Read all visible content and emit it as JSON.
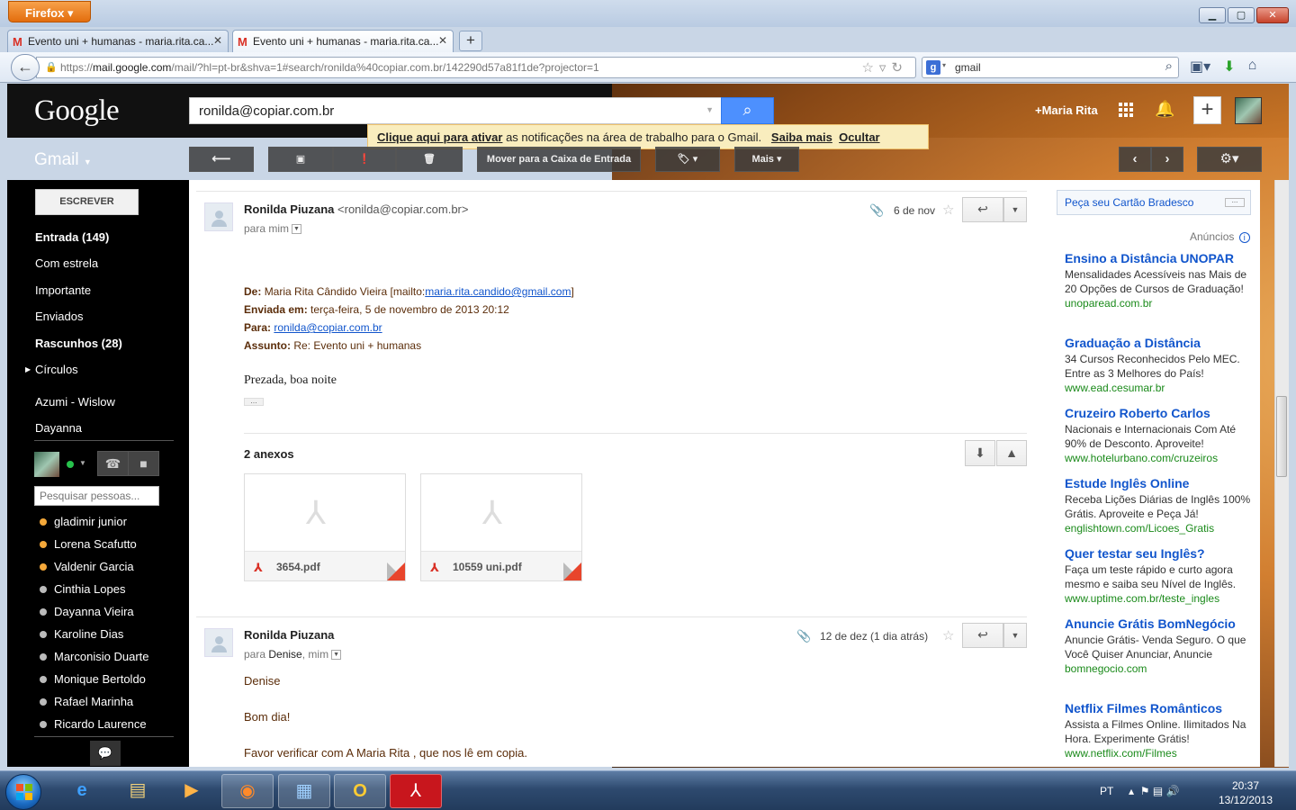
{
  "browser": {
    "menu_button": "Firefox",
    "tabs": [
      {
        "label": "Evento uni + humanas - maria.rita.ca..."
      },
      {
        "label": "Evento uni + humanas - maria.rita.ca..."
      }
    ],
    "url_prefix": "https://",
    "url_host": "mail.google.com",
    "url_path": "/mail/?hl=pt-br&shva=1#search/ronilda%40copiar.com.br/142290d57a81f1de?projector=1",
    "search_value": "gmail"
  },
  "gmail": {
    "logo": "Google",
    "search_value": "ronilda@copiar.com.br",
    "user_link": "+Maria Rita",
    "notification": {
      "activate_link": "Clique aqui para ativar",
      "text": "as notificações na área de trabalho para o Gmail.",
      "learn_more": "Saiba mais",
      "hide": "Ocultar"
    },
    "app_label": "Gmail",
    "toolbar": {
      "move_inbox": "Mover para a Caixa de Entrada",
      "more": "Mais"
    },
    "compose": "ESCREVER",
    "labels": [
      {
        "label": "Entrada (149)"
      },
      {
        "label": "Com estrela"
      },
      {
        "label": "Importante"
      },
      {
        "label": "Enviados"
      },
      {
        "label": "Rascunhos (28)"
      },
      {
        "label": "Círculos"
      },
      {
        "label": "Azumi - Wislow"
      },
      {
        "label": "Dayanna"
      }
    ],
    "people_search_placeholder": "Pesquisar pessoas...",
    "contacts": [
      {
        "name": "gladimir junior",
        "status": "#f4a83a"
      },
      {
        "name": "Lorena Scafutto",
        "status": "#f4a83a"
      },
      {
        "name": "Valdenir Garcia",
        "status": "#f4a83a"
      },
      {
        "name": "Cinthia Lopes",
        "status": "#bbbbbb"
      },
      {
        "name": "Dayanna Vieira",
        "status": "#bbbbbb"
      },
      {
        "name": "Karoline Dias",
        "status": "#bbbbbb"
      },
      {
        "name": "Marconisio Duarte",
        "status": "#bbbbbb"
      },
      {
        "name": "Monique Bertoldo",
        "status": "#bbbbbb"
      },
      {
        "name": "Rafael Marinha",
        "status": "#bbbbbb"
      },
      {
        "name": "Ricardo Laurence",
        "status": "#bbbbbb"
      }
    ]
  },
  "message1": {
    "sender": "Ronilda Piuzana",
    "sender_email": "<ronilda@copiar.com.br>",
    "to_label": "para mim",
    "date": "6 de nov",
    "header": {
      "de_label": "De:",
      "de_value": "Maria Rita Cândido Vieira [mailto:",
      "de_email": "maria.rita.candido@gmail.com",
      "de_close": "]",
      "enviada_label": "Enviada em:",
      "enviada_value": "terça-feira, 5 de novembro de 2013 20:12",
      "para_label": "Para:",
      "para_email": "ronilda@copiar.com.br",
      "assunto_label": "Assunto:",
      "assunto_value": "Re: Evento uni + humanas"
    },
    "body": "Prezada, boa noite",
    "attachments_title": "2 anexos",
    "attachments": [
      {
        "name": "3654.pdf"
      },
      {
        "name": "10559 uni.pdf"
      }
    ]
  },
  "message2": {
    "sender": "Ronilda Piuzana",
    "to_prefix": "para",
    "to_denise": "Denise",
    "to_rest": ", mim",
    "date": "12 de dez (1 dia atrás)",
    "line1": "Denise",
    "line2": "Bom dia!",
    "line3": "Favor verificar com A Maria Rita , que nos lê em copia."
  },
  "ads": {
    "promo": "Peça seu Cartão Bradesco",
    "label": "Anúncios",
    "items": [
      {
        "title": "Ensino a Distância UNOPAR",
        "desc": "Mensalidades Acessíveis nas Mais de 20 Opções de Cursos de Graduação!",
        "url": "unoparead.com.br"
      },
      {
        "title": "Graduação a Distância",
        "desc": "34 Cursos Reconhecidos Pelo MEC. Entre as 3 Melhores do País!",
        "url": "www.ead.cesumar.br"
      },
      {
        "title": "Cruzeiro Roberto Carlos",
        "desc": "Nacionais e Internacionais Com Até 90% de Desconto. Aproveite!",
        "url": "www.hotelurbano.com/cruzeiros"
      },
      {
        "title": "Estude Inglês Online",
        "desc": "Receba Lições Diárias de Inglês 100% Grátis. Aproveite e Peça Já!",
        "url": "englishtown.com/Licoes_Gratis"
      },
      {
        "title": "Quer testar seu Inglês?",
        "desc": "Faça um teste rápido e curto agora mesmo e saiba seu Nível de Inglês.",
        "url": "www.uptime.com.br/teste_ingles"
      },
      {
        "title": "Anuncie Grátis BomNegócio",
        "desc": "Anuncie Grátis- Venda Seguro. O que Você Quiser Anunciar, Anuncie",
        "url": "bomnegocio.com"
      },
      {
        "title": "Netflix Filmes Românticos",
        "desc": "Assista a Filmes Online. Ilimitados Na Hora. Experimente Grátis!",
        "url": "www.netflix.com/Filmes"
      }
    ]
  },
  "taskbar": {
    "lang": "PT",
    "time": "20:37",
    "date": "13/12/2013"
  }
}
